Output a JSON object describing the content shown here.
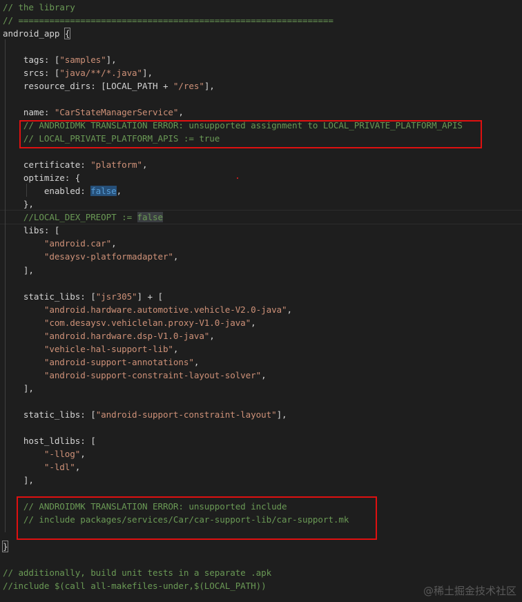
{
  "editor": {
    "colors": {
      "background": "#1e1e1e",
      "text": "#d4d4d4",
      "comment": "#6a9955",
      "string": "#ce9178",
      "keyword": "#569cd6",
      "highlight_box": "#e01010"
    },
    "lines": [
      [
        [
          "comment",
          "// the library"
        ]
      ],
      [
        [
          "comment",
          "// ============================================================="
        ]
      ],
      [
        [
          "key",
          "android_app "
        ],
        [
          "bracket",
          "{"
        ]
      ],
      [],
      [
        [
          "key",
          "    tags"
        ],
        [
          "punct",
          ": ["
        ],
        [
          "string",
          "\"samples\""
        ],
        [
          "punct",
          "],"
        ]
      ],
      [
        [
          "key",
          "    srcs"
        ],
        [
          "punct",
          ": ["
        ],
        [
          "string",
          "\"java/**/*.java\""
        ],
        [
          "punct",
          "],"
        ]
      ],
      [
        [
          "key",
          "    resource_dirs"
        ],
        [
          "punct",
          ": [LOCAL_PATH + "
        ],
        [
          "string",
          "\"/res\""
        ],
        [
          "punct",
          "],"
        ]
      ],
      [],
      [
        [
          "key",
          "    name"
        ],
        [
          "punct",
          ": "
        ],
        [
          "string",
          "\"CarStateManagerService\""
        ],
        [
          "punct",
          ","
        ]
      ],
      [
        [
          "comment",
          "    // ANDROIDMK TRANSLATION ERROR: unsupported assignment to LOCAL_PRIVATE_PLATFORM_APIS"
        ]
      ],
      [
        [
          "comment",
          "    // LOCAL_PRIVATE_PLATFORM_APIS := true"
        ]
      ],
      [],
      [
        [
          "key",
          "    certificate"
        ],
        [
          "punct",
          ": "
        ],
        [
          "string",
          "\"platform\""
        ],
        [
          "punct",
          ","
        ]
      ],
      [
        [
          "key",
          "    optimize"
        ],
        [
          "punct",
          ": {"
        ]
      ],
      [
        [
          "key",
          "        enabled"
        ],
        [
          "punct",
          ": "
        ],
        [
          "bool",
          "false"
        ],
        [
          "punct",
          ","
        ]
      ],
      [
        [
          "punct",
          "    },"
        ]
      ],
      [
        [
          "comment",
          "    //LOCAL_DEX_PREOPT := "
        ],
        [
          "cbool",
          "false"
        ]
      ],
      [
        [
          "key",
          "    libs"
        ],
        [
          "punct",
          ": ["
        ]
      ],
      [
        [
          "string",
          "        \"android.car\""
        ],
        [
          "punct",
          ","
        ]
      ],
      [
        [
          "string",
          "        \"desaysv-platformadapter\""
        ],
        [
          "punct",
          ","
        ]
      ],
      [
        [
          "punct",
          "    ],"
        ]
      ],
      [],
      [
        [
          "key",
          "    static_libs"
        ],
        [
          "punct",
          ": ["
        ],
        [
          "string",
          "\"jsr305\""
        ],
        [
          "punct",
          "] + ["
        ]
      ],
      [
        [
          "string",
          "        \"android.hardware.automotive.vehicle-V2.0-java\""
        ],
        [
          "punct",
          ","
        ]
      ],
      [
        [
          "string",
          "        \"com.desaysv.vehiclelan.proxy-V1.0-java\""
        ],
        [
          "punct",
          ","
        ]
      ],
      [
        [
          "string",
          "        \"android.hardware.dsp-V1.0-java\""
        ],
        [
          "punct",
          ","
        ]
      ],
      [
        [
          "string",
          "        \"vehicle-hal-support-lib\""
        ],
        [
          "punct",
          ","
        ]
      ],
      [
        [
          "string",
          "        \"android-support-annotations\""
        ],
        [
          "punct",
          ","
        ]
      ],
      [
        [
          "string",
          "        \"android-support-constraint-layout-solver\""
        ],
        [
          "punct",
          ","
        ]
      ],
      [
        [
          "punct",
          "    ],"
        ]
      ],
      [],
      [
        [
          "key",
          "    static_libs"
        ],
        [
          "punct",
          ": ["
        ],
        [
          "string",
          "\"android-support-constraint-layout\""
        ],
        [
          "punct",
          "],"
        ]
      ],
      [],
      [
        [
          "key",
          "    host_ldlibs"
        ],
        [
          "punct",
          ": ["
        ]
      ],
      [
        [
          "string",
          "        \"-llog\""
        ],
        [
          "punct",
          ","
        ]
      ],
      [
        [
          "string",
          "        \"-ldl\""
        ],
        [
          "punct",
          ","
        ]
      ],
      [
        [
          "punct",
          "    ],"
        ]
      ],
      [],
      [
        [
          "comment",
          "    // ANDROIDMK TRANSLATION ERROR: unsupported include"
        ]
      ],
      [
        [
          "comment",
          "    // include packages/services/Car/car-support-lib/car-support.mk"
        ]
      ],
      [],
      [
        [
          "bracket",
          "}"
        ]
      ],
      [],
      [
        [
          "comment",
          "// additionally, build unit tests in a separate .apk"
        ]
      ],
      [
        [
          "comment",
          "//include $(call all-makefiles-under,$(LOCAL_PATH))"
        ]
      ]
    ]
  },
  "watermark": "@稀土掘金技术社区"
}
